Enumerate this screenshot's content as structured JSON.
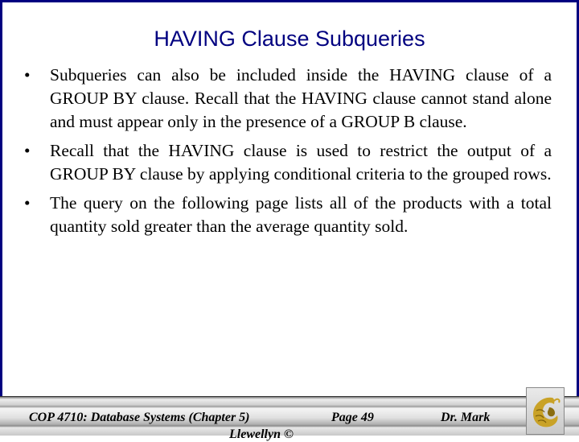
{
  "slide": {
    "title": "HAVING Clause Subqueries",
    "bullets": [
      "Subqueries can also be included inside the HAVING clause of a GROUP BY clause.  Recall that the HAVING clause cannot stand alone and must appear only in the presence of a GROUP B clause.",
      "Recall that the HAVING clause is used to restrict the output of a GROUP BY clause by applying conditional criteria to the grouped rows.",
      "The query on the following page lists all of the products with a total quantity sold greater than the average quantity sold."
    ],
    "bullet_glyph": "•"
  },
  "footer": {
    "course": "COP 4710: Database Systems  (Chapter 5)",
    "page": "Page 49",
    "author": "Dr. Mark",
    "author_cont": "Llewellyn ©",
    "logo_icon": "ucf-pegasus-logo"
  },
  "colors": {
    "border": "#000080",
    "title": "#000080",
    "logo_gold": "#c9a227"
  }
}
